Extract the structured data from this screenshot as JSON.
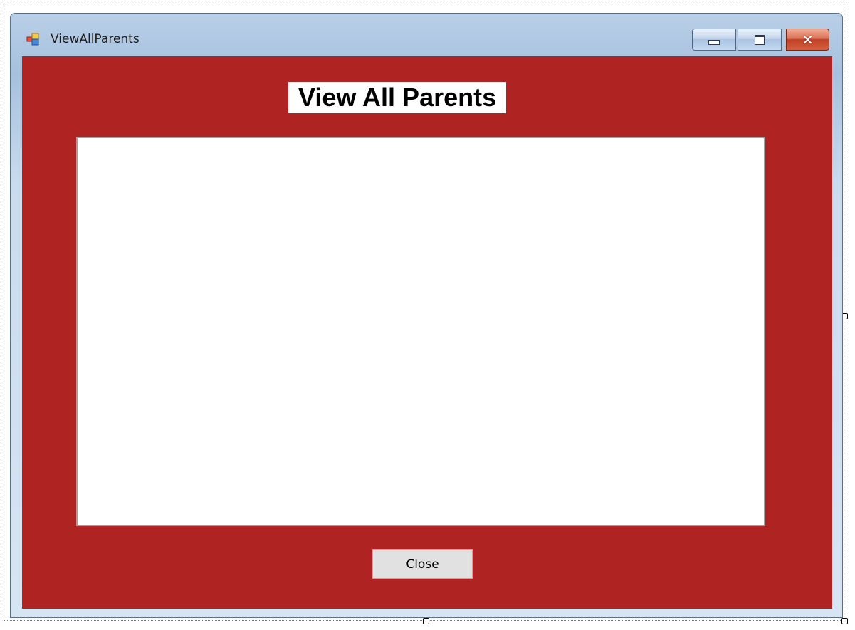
{
  "window": {
    "title": "ViewAllParents",
    "controls": {
      "minimize_icon": "minimize-icon",
      "maximize_icon": "maximize-icon",
      "close_icon": "close-icon"
    }
  },
  "form": {
    "background_color": "#b02323",
    "heading": "View All Parents",
    "parents_grid": {
      "rows": []
    },
    "close_button_label": "Close"
  }
}
